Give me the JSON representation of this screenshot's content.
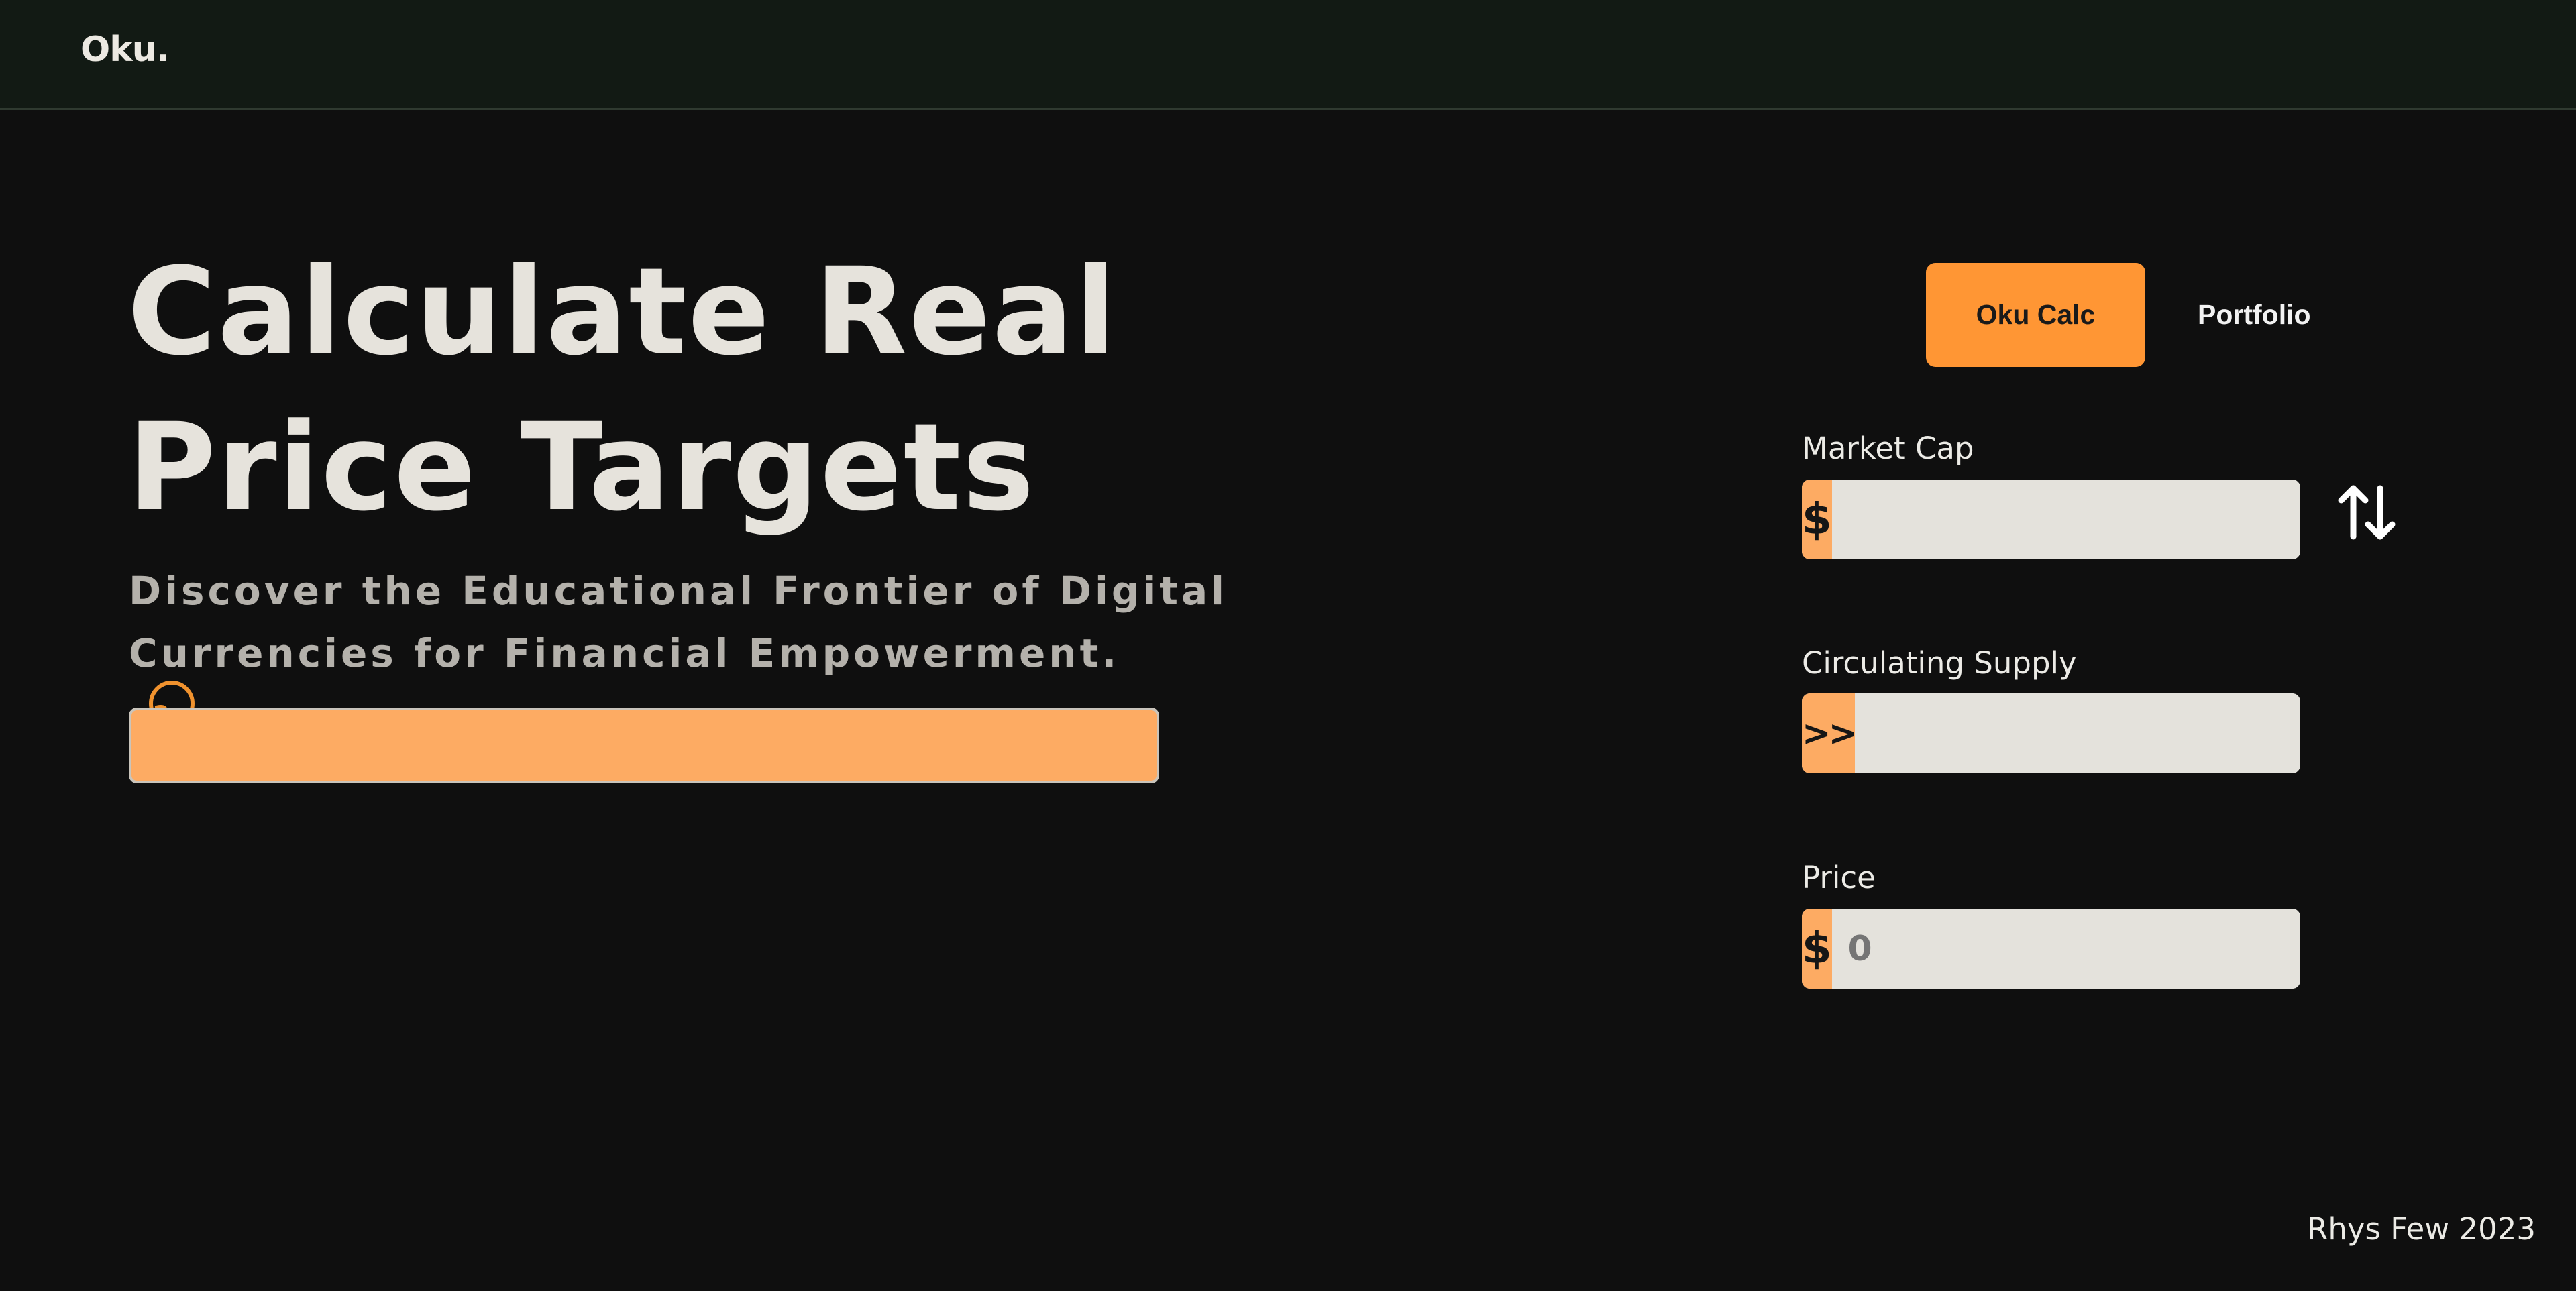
{
  "brand": "Oku.",
  "hero": {
    "title_line1": "Calculate Real",
    "title_line2": "Price Targets",
    "subtitle_line1": "Discover the Educational Frontier of Digital",
    "subtitle_line2": "Currencies for Financial Empowerment.",
    "help_glyph": "?"
  },
  "progress": {
    "value": 1.0
  },
  "tabs": [
    {
      "label": "Oku Calc",
      "active": true
    },
    {
      "label": "Portfolio",
      "active": false
    }
  ],
  "fields": {
    "market_cap": {
      "label": "Market Cap",
      "prefix": "$",
      "value": ""
    },
    "circulating_supply": {
      "label": "Circulating Supply",
      "prefix": ">>",
      "value": ""
    },
    "price": {
      "label": "Price",
      "prefix": "$",
      "placeholder": "0",
      "value": ""
    }
  },
  "icons": {
    "help": "question-circle-icon",
    "swap": "swap-vertical-arrows-icon"
  },
  "colors": {
    "accent": "#ff9634",
    "accent_light": "#fdab63",
    "background": "#0f0f0f",
    "topbar": "#121a14"
  },
  "footer": "Rhys Few 2023"
}
